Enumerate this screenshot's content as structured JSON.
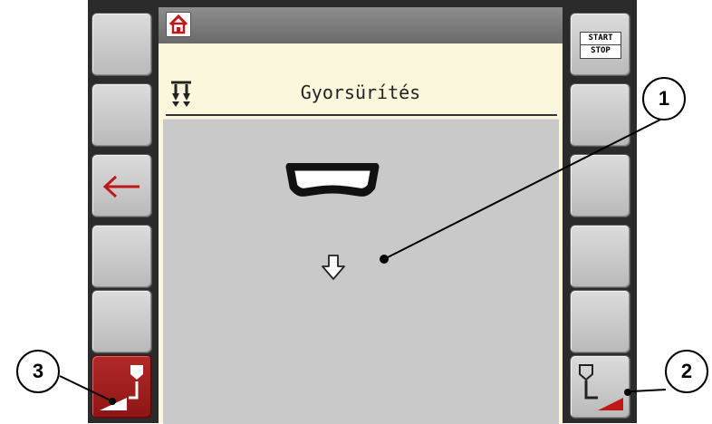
{
  "screen": {
    "title": "Gyorsürítés",
    "title_icon": "hopper-emptying-icon",
    "main_icons": [
      "hopper-icon",
      "arrow-down-icon"
    ]
  },
  "topbar": {
    "home_icon": "home-icon"
  },
  "softkeys_left": [
    "",
    "",
    "back-arrow-icon",
    "",
    "",
    "hopper-empty-left-icon"
  ],
  "softkeys_right": [
    "start-stop",
    "",
    "",
    "",
    "",
    "hopper-empty-right-icon"
  ],
  "start_stop": {
    "line1": "START",
    "line2": "STOP"
  },
  "callouts": [
    "1",
    "2",
    "3"
  ],
  "colors": {
    "accent_red": "#b22a2a",
    "screen_bg": "#fbf7dc",
    "panel_bg": "#c9c9c9"
  }
}
